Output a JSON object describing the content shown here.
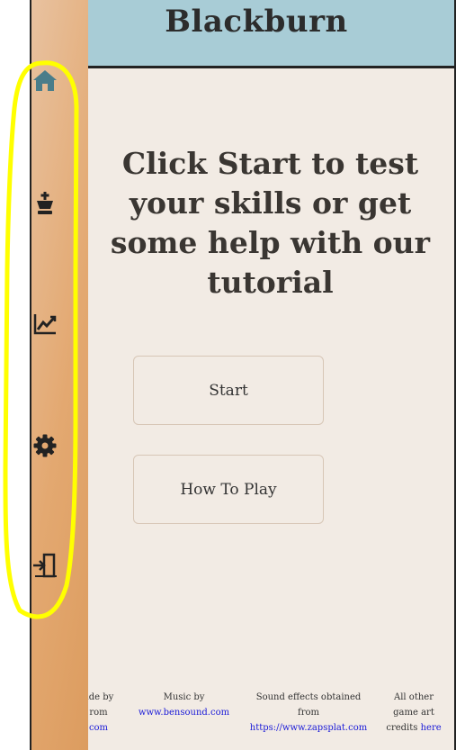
{
  "header": {
    "title": "Blackburn"
  },
  "main": {
    "headline": "Click Start to test your skills or get some help with our tutorial",
    "start_label": "Start",
    "howto_label": "How To Play"
  },
  "sidebar": {
    "items": [
      {
        "icon": "home-icon"
      },
      {
        "icon": "chess-king-icon"
      },
      {
        "icon": "chart-icon"
      },
      {
        "icon": "gear-icon"
      },
      {
        "icon": "exit-door-icon"
      }
    ]
  },
  "footer": {
    "credit1": {
      "line1": "ade by",
      "line2": "rom",
      "link": "com"
    },
    "credit2": {
      "line1": "Music by",
      "link": "www.bensound.com"
    },
    "credit3": {
      "line1": "Sound effects obtained",
      "line2": "from",
      "link": "https://www.zapsplat.com"
    },
    "credit4": {
      "line1": "All other",
      "line2": "game art",
      "line3": "credits",
      "link": "here"
    }
  },
  "colors": {
    "header_bg": "#a8ccd6",
    "page_bg": "#f2ebe4",
    "sidebar_gradient": "#e3a870",
    "annotation": "#ffff00",
    "home_icon": "#4a7d8a",
    "link": "#1a1ad8"
  }
}
